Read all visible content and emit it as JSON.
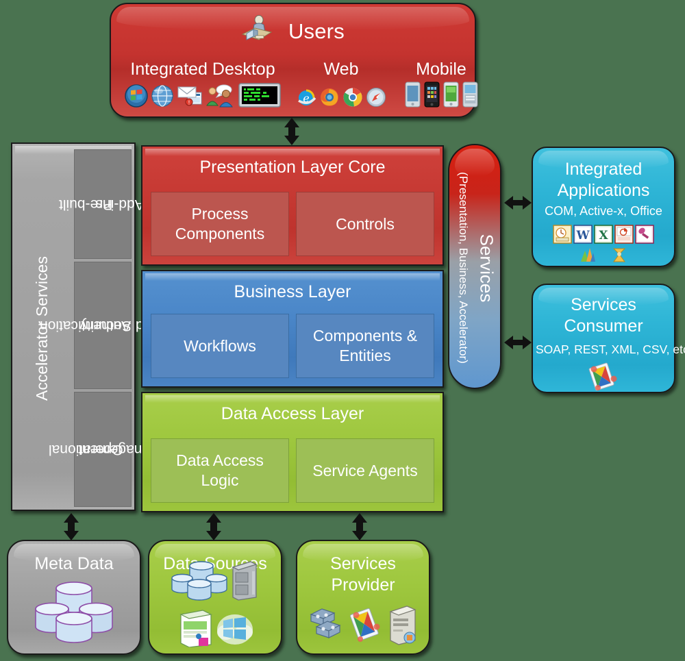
{
  "background_color": "#4a7350",
  "users": {
    "title": "Users",
    "title_icon": "user-at-desk-icon",
    "columns": [
      {
        "label": "Integrated Desktop",
        "icons": [
          "windows-logo-icon",
          "globe-icon",
          "email-envelope-icon",
          "chat-people-icon",
          "terminal-console-icon"
        ]
      },
      {
        "label": "Web",
        "icons": [
          "internet-explorer-icon",
          "firefox-icon",
          "chrome-icon",
          "safari-icon"
        ]
      },
      {
        "label": "Mobile",
        "icons": [
          "android-phone-icon",
          "iphone-icon",
          "smartphone-green-icon",
          "smartphone-blue-icon"
        ]
      }
    ]
  },
  "accelerator": {
    "label": "Accelerator Services",
    "sub_boxes": [
      {
        "lines": [
          "Pre-built",
          "Add-ins"
        ]
      },
      {
        "lines": [
          "Authentication",
          "and Security"
        ]
      },
      {
        "lines": [
          "Operational",
          "Management"
        ]
      }
    ]
  },
  "layers": [
    {
      "id": "presentation",
      "title": "Presentation Layer Core",
      "color": "#c63933",
      "cells": [
        {
          "lines": [
            "Process",
            "Components"
          ]
        },
        {
          "lines": [
            "Controls"
          ]
        }
      ]
    },
    {
      "id": "business",
      "title": "Business Layer",
      "color": "#4a86c8",
      "cells": [
        {
          "lines": [
            "Workflows"
          ]
        },
        {
          "lines": [
            "Components &",
            "Entities"
          ]
        }
      ]
    },
    {
      "id": "data_access",
      "title": "Data Access Layer",
      "color": "#9ec73e",
      "cells": [
        {
          "lines": [
            "Data Access",
            "Logic"
          ]
        },
        {
          "lines": [
            "Service Agents"
          ]
        }
      ]
    }
  ],
  "services_bar": {
    "main_label": "Services",
    "sub_label": "(Presentation, Business, Accelerator)",
    "gradient_from": "#d81f10",
    "gradient_to": "#5f97cf"
  },
  "right_boxes": [
    {
      "id": "integrated_applications",
      "title_lines": [
        "Integrated",
        "Applications"
      ],
      "subtitle": "COM, Active-x, Office",
      "icons": [
        "outlook-icon",
        "word-icon",
        "excel-icon",
        "powerpoint-icon",
        "access-icon",
        "dynamics-icon",
        "biztalk-icon"
      ],
      "color": "#2eb5d6"
    },
    {
      "id": "services_consumer",
      "title_lines": [
        "Services",
        "Consumer"
      ],
      "subtitle": "SOAP, REST, XML, CSV, etc.",
      "icons": [
        "service-cards-icon"
      ],
      "color": "#2eb5d6"
    }
  ],
  "bottom_boxes": [
    {
      "id": "meta_data",
      "title_lines": [
        "Meta Data"
      ],
      "color": "#a3a3a3",
      "icons": [
        "database-cluster-icon"
      ]
    },
    {
      "id": "data_sources",
      "title_lines": [
        "Data Sources"
      ],
      "color": "#9ec73e",
      "icons": [
        "database-cluster-icon",
        "server-rack-icon",
        "software-box-icon",
        "windows-cloud-icon"
      ]
    },
    {
      "id": "services_provider",
      "title_lines": [
        "Services",
        "Provider"
      ],
      "color": "#9ec73e",
      "icons": [
        "pipeline-icon",
        "service-cards-icon",
        "server-tower-icon"
      ]
    }
  ],
  "arrows": [
    {
      "name": "users-to-presentation",
      "orientation": "vertical"
    },
    {
      "name": "services-to-integrated-applications",
      "orientation": "horizontal"
    },
    {
      "name": "services-to-services-consumer",
      "orientation": "horizontal"
    },
    {
      "name": "accelerator-to-meta-data",
      "orientation": "vertical"
    },
    {
      "name": "data-access-to-data-sources",
      "orientation": "vertical"
    },
    {
      "name": "data-access-to-services-provider",
      "orientation": "vertical"
    }
  ]
}
